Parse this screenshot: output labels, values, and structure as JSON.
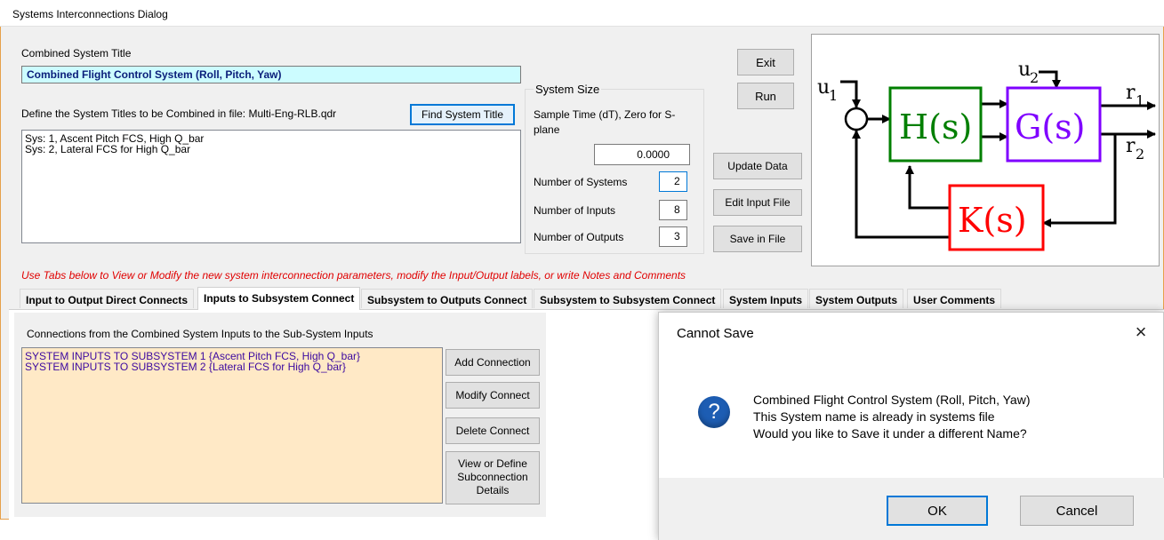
{
  "window": {
    "title": "Systems Interconnections Dialog"
  },
  "combined": {
    "label": "Combined System Title",
    "value": "Combined Flight Control System (Roll, Pitch, Yaw)",
    "define_label": "Define the System Titles to be Combined in file: Multi-Eng-RLB.qdr",
    "find_button": "Find System Title",
    "systems": [
      "Sys: 1, Ascent Pitch FCS, High Q_bar",
      "Sys: 2, Lateral FCS for High Q_bar"
    ]
  },
  "system_size": {
    "heading": "System Size",
    "sample_time_label": "Sample Time (dT), Zero for S-plane",
    "sample_time_value": "0.0000",
    "num_systems_label": "Number of Systems",
    "num_systems_value": "2",
    "num_inputs_label": "Number of Inputs",
    "num_inputs_value": "8",
    "num_outputs_label": "Number of Outputs",
    "num_outputs_value": "3"
  },
  "buttons": {
    "exit": "Exit",
    "run": "Run",
    "update": "Update Data",
    "edit": "Edit Input File",
    "save": "Save in File"
  },
  "diagram": {
    "u1": "u",
    "u1_sub": "1",
    "u2": "u",
    "u2_sub": "2",
    "r1": "r",
    "r1_sub": "1",
    "r2": "r",
    "r2_sub": "2",
    "h": "H(s)",
    "g": "G(s)",
    "k": "K(s)",
    "colors": {
      "h": "#007f00",
      "g": "#7f00ff",
      "k": "#ff0000"
    }
  },
  "hint": "Use Tabs below to View or Modify the new system interconnection parameters, modify the Input/Output labels, or write Notes and Comments",
  "tabs": [
    "Input to Output Direct Connects",
    "Inputs to Subsystem Connect",
    "Subsystem to Outputs Connect",
    "Subsystem to Subsystem Connect",
    "System Inputs",
    "System Outputs",
    "User Comments"
  ],
  "tab_page": {
    "heading": "Connections from the Combined System Inputs to the Sub-System Inputs",
    "items": [
      "SYSTEM INPUTS TO SUBSYSTEM  1 {Ascent Pitch FCS, High Q_bar}",
      "SYSTEM INPUTS TO SUBSYSTEM  2 {Lateral FCS for High Q_bar}"
    ],
    "add": "Add Connection",
    "modify": "Modify Connect",
    "delete": "Delete Connect",
    "view_lines": [
      "View or Define",
      "Subconnection",
      "Details"
    ]
  },
  "msgbox": {
    "title": "Cannot Save",
    "close": "×",
    "icon": "?",
    "lines": [
      "Combined Flight Control System (Roll, Pitch, Yaw)",
      "This System name is already in systems file",
      "Would you like to Save it under a different Name?"
    ],
    "ok": "OK",
    "cancel": "Cancel"
  }
}
